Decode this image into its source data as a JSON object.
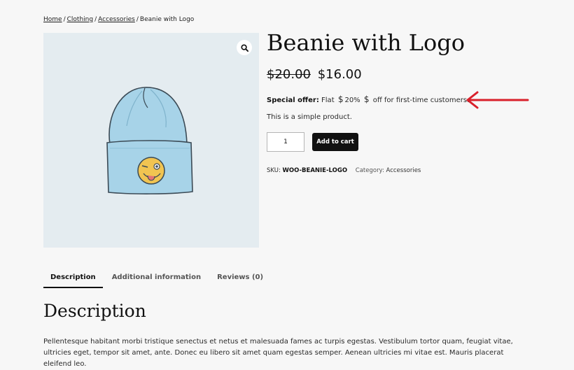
{
  "breadcrumb": {
    "home": "Home",
    "clothing": "Clothing",
    "accessories": "Accessories",
    "current": "Beanie with Logo",
    "separator": "/"
  },
  "gallery": {
    "zoom_icon": "magnifier-icon",
    "image": "beanie-with-winking-emoji-logo"
  },
  "product": {
    "title": "Beanie with Logo",
    "regular_price": "$20.00",
    "sale_price": "$16.00",
    "offer_label": "Special offer:",
    "offer_prefix": "Flat",
    "offer_currency": "$",
    "offer_value": "20%",
    "offer_suffix": "off for first-time customers.",
    "short_description": "This is a simple product.",
    "quantity": "1",
    "add_to_cart_label": "Add to cart",
    "sku_label": "SKU:",
    "sku_value": "WOO-BEANIE-LOGO",
    "category_label": "Category:",
    "category_value": "Accessories"
  },
  "annotation": {
    "arrow_color": "#d9202b"
  },
  "tabs": [
    {
      "label": "Description",
      "active": true
    },
    {
      "label": "Additional information",
      "active": false
    },
    {
      "label": "Reviews (0)",
      "active": false
    }
  ],
  "description": {
    "heading": "Description",
    "body": "Pellentesque habitant morbi tristique senectus et netus et malesuada fames ac turpis egestas. Vestibulum tortor quam, feugiat vitae, ultricies eget, tempor sit amet, ante. Donec eu libero sit amet quam egestas semper. Aenean ultricies mi vitae est. Mauris placerat eleifend leo."
  }
}
